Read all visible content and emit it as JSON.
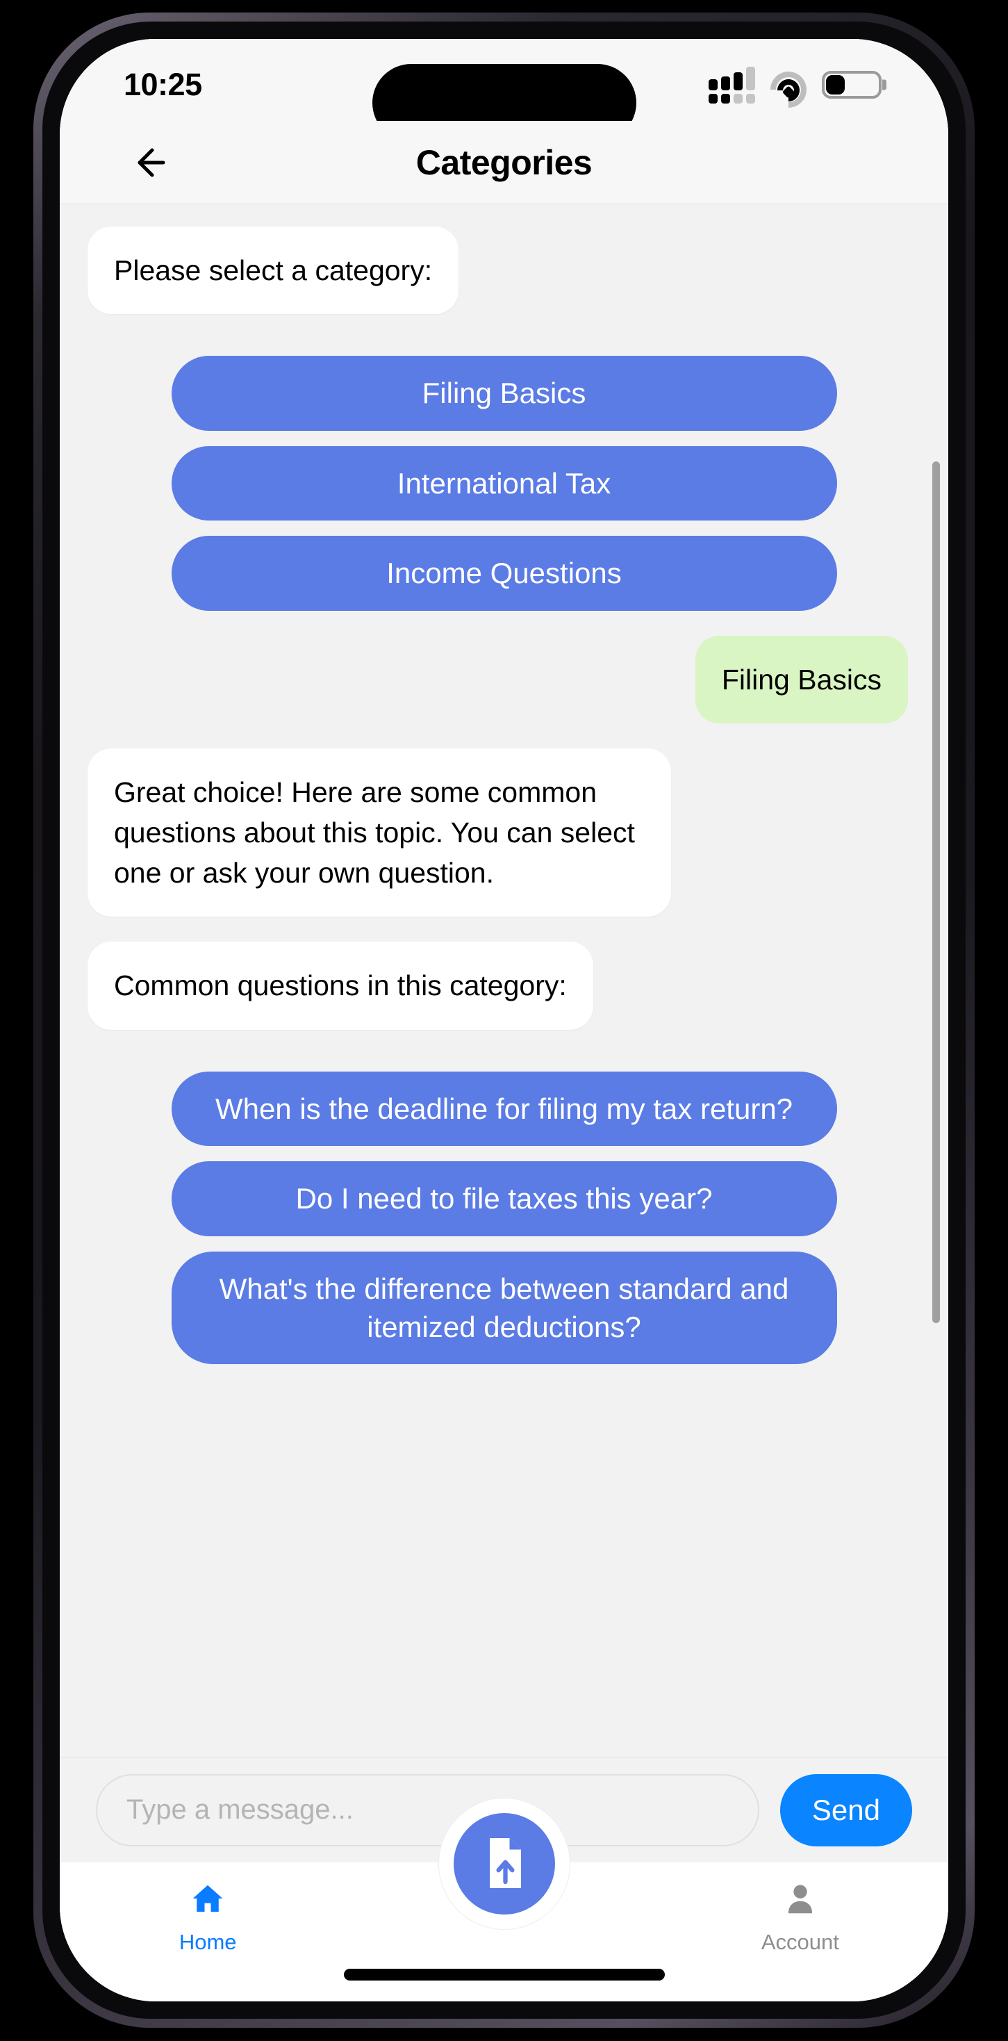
{
  "statusbar": {
    "time": "10:25",
    "cellular_icon": "cellular-signal-icon",
    "wifi_icon": "wifi-icon",
    "battery_icon": "battery-icon",
    "battery_level_pct": 35
  },
  "header": {
    "back_icon": "back-arrow-icon",
    "title": "Categories"
  },
  "chat": {
    "prompt_message": "Please select a category:",
    "category_options": [
      "Filing Basics",
      "International Tax",
      "Income Questions"
    ],
    "user_selection": "Filing Basics",
    "bot_reply": "Great choice! Here are some common questions about this topic. You can select one or ask your own question.",
    "questions_header": "Common questions in this category:",
    "suggested_questions": [
      "When is the deadline for filing my tax return?",
      "Do I need to file taxes this year?",
      "What's the difference between standard and itemized deductions?"
    ]
  },
  "composer": {
    "placeholder": "Type a message...",
    "input_value": "",
    "send_label": "Send"
  },
  "tabbar": {
    "items": [
      {
        "label": "Home",
        "icon": "home-icon",
        "active": true
      },
      {
        "label": "Account",
        "icon": "person-icon",
        "active": false
      }
    ],
    "fab_icon": "document-upload-icon"
  },
  "colors": {
    "chip_blue": "#5b7be5",
    "user_bubble_green": "#daf5c4",
    "send_blue": "#0a84ff",
    "tab_active_blue": "#0a7cff",
    "tab_inactive_gray": "#8e8e8e",
    "screen_bg": "#f2f2f2",
    "bar_bg": "#f7f7f7"
  }
}
